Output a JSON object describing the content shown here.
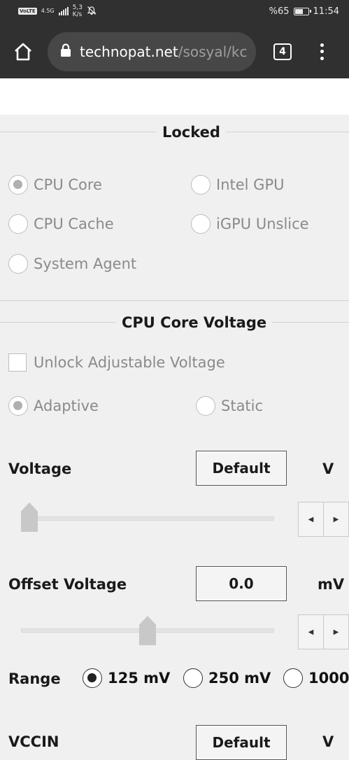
{
  "status_bar": {
    "volte": "VoLTE",
    "network": "4.5G",
    "speed_value": "5,3",
    "speed_unit": "K/s",
    "battery": "%65",
    "battery_level": 0.65,
    "time": "11:54"
  },
  "browser": {
    "url_domain": "technopat.net",
    "url_path": "/sosyal/kc",
    "tab_count": "4"
  },
  "locked_section": {
    "title": "Locked",
    "options": [
      {
        "label": "CPU Core",
        "checked": true
      },
      {
        "label": "Intel GPU",
        "checked": false
      },
      {
        "label": "CPU Cache",
        "checked": false
      },
      {
        "label": "iGPU Unslice",
        "checked": false
      },
      {
        "label": "System Agent",
        "checked": false
      }
    ]
  },
  "voltage_section": {
    "title": "CPU Core Voltage",
    "unlock_label": "Unlock Adjustable Voltage",
    "mode_adaptive": "Adaptive",
    "mode_static": "Static"
  },
  "voltage": {
    "label": "Voltage",
    "value": "Default",
    "unit": "V",
    "slider_level": 0.0
  },
  "offset": {
    "label": "Offset Voltage",
    "value": "0.0",
    "unit": "mV",
    "slider_level": 0.5
  },
  "range": {
    "label": "Range",
    "options": [
      {
        "label": "125 mV",
        "checked": true
      },
      {
        "label": "250 mV",
        "checked": false
      },
      {
        "label": "1000",
        "checked": false
      }
    ]
  },
  "vccin": {
    "label": "VCCIN",
    "value": "Default",
    "unit": "V"
  },
  "colors": {
    "chrome_bar": "#303030",
    "url_field": "#474747",
    "panel_bg": "#f0f0f0",
    "disabled_text": "#8a8a8a"
  }
}
